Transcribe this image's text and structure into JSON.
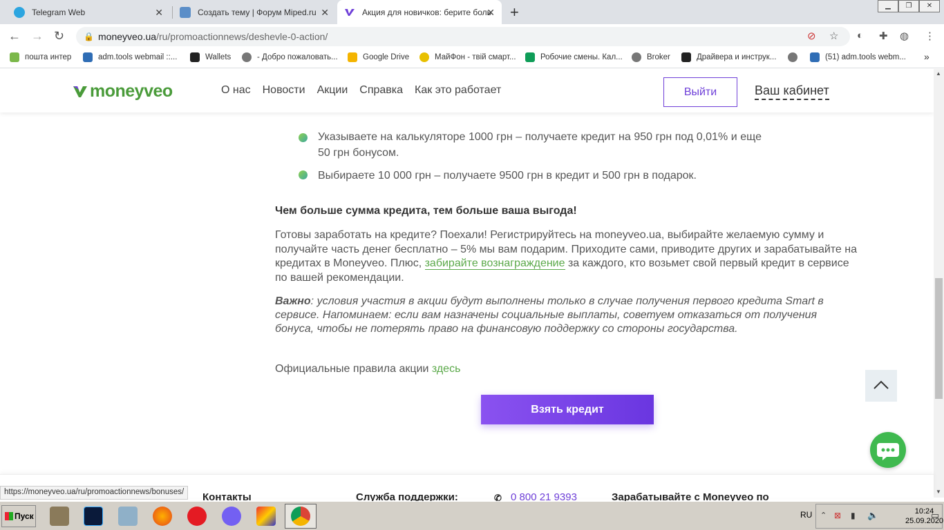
{
  "browser": {
    "tabs": [
      {
        "title": "Telegram Web",
        "color": "#2ca5e0"
      },
      {
        "title": "Создать тему | Форум Miped.ru",
        "color": "#5b8ec8"
      },
      {
        "title": "Акция для новичков: берите боль",
        "color": "#6e3fd8"
      }
    ],
    "url_host": "moneyveo.ua",
    "url_path": "/ru/promoactionnews/deshevle-0-action/",
    "bookmarks": [
      {
        "label": "пошта интер",
        "color": "#7bb84a"
      },
      {
        "label": "adm.tools webmail ::...",
        "color": "#2f6db5"
      },
      {
        "label": "Wallets",
        "color": "#222222"
      },
      {
        "label": "- Добро пожаловать...",
        "color": "#555555"
      },
      {
        "label": "Google Drive",
        "color": "#f4b400"
      },
      {
        "label": "МайФон - твій смарт...",
        "color": "#e8c000"
      },
      {
        "label": "Робочие смены. Кал...",
        "color": "#0f9d58"
      },
      {
        "label": "Broker",
        "color": "#555555"
      },
      {
        "label": "Драйвера и инструк...",
        "color": "#222222"
      },
      {
        "label": "(51) adm.tools webm...",
        "color": "#2f6db5"
      }
    ]
  },
  "site": {
    "logo": "moneyveo",
    "nav": [
      "О нас",
      "Новости",
      "Акции",
      "Справка",
      "Как это работает"
    ],
    "logout": "Выйти",
    "cabinet": "Ваш кабинет"
  },
  "content": {
    "bullets": [
      "Указываете на калькуляторе 1000 грн – получаете кредит на 950 грн под 0,01% и еще 50 грн бонусом.",
      "Выбираете 10 000 грн – получаете 9500 грн в кредит и 500 грн в подарок."
    ],
    "bold_line": "Чем больше сумма кредита, тем больше ваша выгода!",
    "main_before": "Готовы заработать на кредите? Поехали! Регистрируйтесь на moneyveo.ua, выбирайте желаемую сумму и получайте часть денег бесплатно – 5% мы вам подарим. Приходите сами, приводите других и зарабатывайте на кредитах в Moneyveo. Плюс, ",
    "main_link": "забирайте вознаграждение",
    "main_after": " за каждого, кто возьмет свой первый кредит в сервисе по вашей рекомендации.",
    "note_label": "Важно",
    "note_text": ": условия участия в акции будут выполнены только в случае получения первого кредита Smart в сервисе. Напоминаем: если вам назначены социальные выплаты, советуем отказаться от получения бонуса, чтобы не потерять право на финансовую поддержку со стороны государства.",
    "rules_text": "Официальные правила акции ",
    "rules_link": "здесь",
    "credit_button": "Взять кредит"
  },
  "footer": {
    "contacts": "Контакты",
    "support": "Служба поддержки:",
    "phone": "0 800 21 9393",
    "earn": "Зарабатывайте с Moneyveo по"
  },
  "status_url": "https://moneyveo.ua/ru/promoactionnews/bonuses/",
  "taskbar": {
    "start": "Пуск",
    "lang": "RU",
    "time": "10:24",
    "date": "25.09.2020"
  },
  "colors": {
    "brand_green": "#4a9b3a",
    "brand_purple": "#6e3fd8"
  }
}
